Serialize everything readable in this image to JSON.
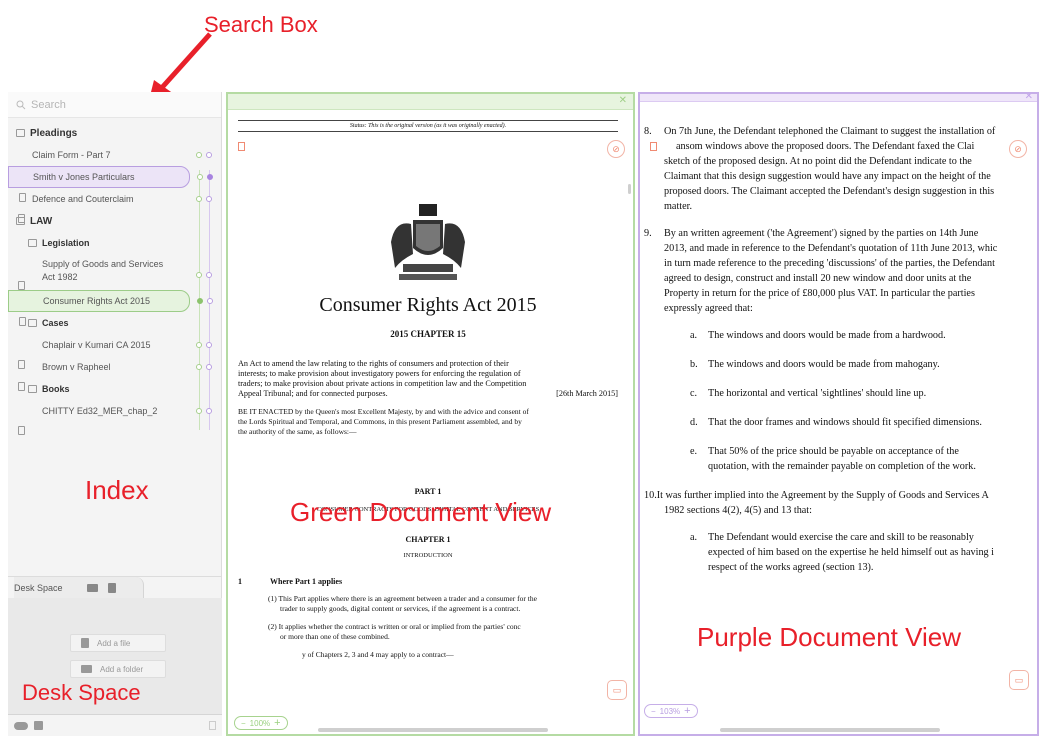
{
  "annotations": {
    "search_box": "Search Box",
    "index": "Index",
    "desk_space": "Desk Space",
    "green_view": "Green Document View",
    "purple_view": "Purple Document View"
  },
  "sidebar": {
    "search_placeholder": "Search",
    "groups": {
      "pleadings": "Pleadings",
      "claim_form": "Claim Form - Part 7",
      "smith_jones": "Smith v Jones Particulars",
      "defence": "Defence and Couterclaim",
      "law": "LAW",
      "legislation": "Legislation",
      "supply_1": "Supply of Goods and Services",
      "supply_2": "Act 1982",
      "consumer": "Consumer Rights Act 2015",
      "cases": "Cases",
      "chaplair": "Chaplair v Kumari CA 2015",
      "brown": "Brown v Rapheel",
      "books": "Books",
      "chitty": "CHITTY Ed32_MER_chap_2"
    },
    "desk": {
      "title": "Desk Space",
      "add_file": "Add a file",
      "add_folder": "Add a folder"
    }
  },
  "green_doc": {
    "status": "Status: This is the original version (as it was originally enacted).",
    "title": "Consumer Rights Act 2015",
    "chapter": "2015 CHAPTER 15",
    "intro_1": "An Act to amend the law relating to the rights of consumers and protection of their",
    "intro_2": "interests; to make provision about investigatory powers for enforcing the regulation of",
    "intro_3": "traders; to make provision about private actions in competition law and the Competition",
    "intro_4": "Appeal Tribunal; and for connected purposes.",
    "intro_date": "[26th March 2015]",
    "enact_1": "BE IT ENACTED by the Queen's most Excellent Majesty, by and with the advice and consent of",
    "enact_2": "the Lords Spiritual and Temporal, and Commons, in this present Parliament assembled, and by",
    "enact_3": "the authority of the same, as follows:—",
    "part": "PART 1",
    "part_title": "CONSUMER CONTRACTS FOR GOODS, DIGITAL CONTENT AND SERVICES",
    "chapter1": "CHAPTER 1",
    "introduction": "INTRODUCTION",
    "s1_num": "1",
    "s1_title": "Where Part 1 applies",
    "s1_1a": "(1) This Part applies where there is an agreement between a trader and a consumer for the",
    "s1_1b": "trader to supply goods, digital content or services, if the agreement is a contract.",
    "s1_2a": "(2) It applies whether the contract is written or oral or implied from the parties' conc",
    "s1_2b": "or more than one of these combined.",
    "s1_3": "y of Chapters 2, 3 and 4 may apply to a contract—",
    "zoom": "100%"
  },
  "purple_doc": {
    "p8_n": "8.",
    "p8_l1": "On 7th June, the Defendant telephoned the Claimant to suggest the installation of",
    "p8_l2": "ansom windows above the proposed doors. The Defendant faxed the Clai",
    "p8_l3": "sketch of the proposed design. At no point did the Defendant indicate to the",
    "p8_l4": "Claimant that this design suggestion would have any impact on the height of the",
    "p8_l5": "proposed doors. The Claimant accepted the Defendant's design suggestion in this",
    "p8_l6": "matter.",
    "p9_n": "9.",
    "p9_l1": "By an written agreement ('the Agreement') signed by the parties on 14th June",
    "p9_l2": "2013, and made in reference to the Defendant's quotation of 11th June 2013, whic",
    "p9_l3": "in turn made reference to the preceding 'discussions' of the parties, the Defendant",
    "p9_l4": "agreed to design, construct and install 20 new window and door units at the",
    "p9_l5": "Property in return for the price of £80,000 plus VAT. In particular the parties",
    "p9_l6": "expressly agreed that:",
    "a_n": "a.",
    "a": "The windows and doors would be made from a hardwood.",
    "b_n": "b.",
    "b": "The windows and doors would be made from mahogany.",
    "c_n": "c.",
    "c": "The horizontal and vertical 'sightlines' should line up.",
    "d_n": "d.",
    "d": "That the door frames and windows should fit specified dimensions.",
    "e_n": "e.",
    "e_l1": "That 50% of the price should be payable on acceptance of the",
    "e_l2": "quotation, with the remainder payable on completion of the work.",
    "p10_n": "10.",
    "p10_l1": "It was further implied into the Agreement by the Supply of Goods and Services A",
    "p10_l2": "1982 sections 4(2), 4(5) and 13 that:",
    "a2_n": "a.",
    "a2_l1": "The Defendant would exercise the care and skill to be reasonably",
    "a2_l2": "expected of him based on the expertise he held himself out as having i",
    "a2_l3": "respect of the works agreed (section 13).",
    "zoom": "103%"
  },
  "colors": {
    "annotation_red": "#e8202a",
    "green_accent": "#b5dba3",
    "purple_accent": "#c6aee8",
    "note_orange": "#f08a72"
  }
}
